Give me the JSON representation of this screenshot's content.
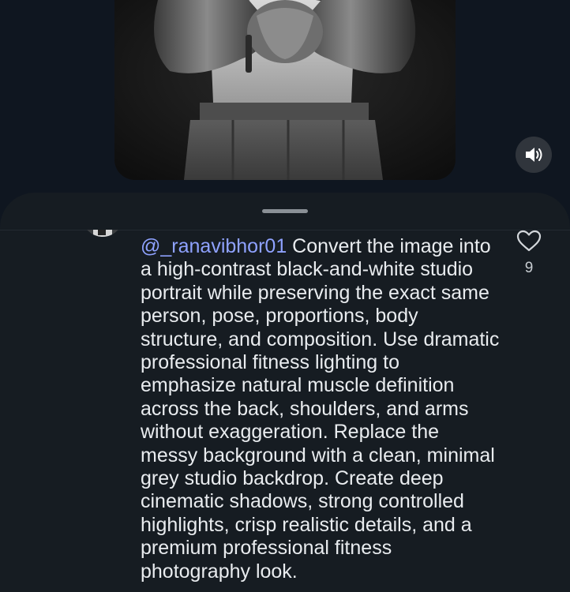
{
  "media": {
    "image_description_icon": "person-photo",
    "mute_icon": "speaker-icon"
  },
  "comment": {
    "mention": "@_ranavibhor01",
    "text": " Convert the image into a high-contrast black-and-white studio portrait while preserving the exact same person, pose, proportions, body structure, and composition. Use dramatic professional fitness lighting to emphasize natural muscle definition across the back, shoulders, and arms without exaggeration. Replace the messy background with a clean, minimal grey studio backdrop. Create deep cinematic shadows, strong controlled highlights, crisp realistic details, and a premium professional fitness photography look.",
    "like_count": "9"
  },
  "colors": {
    "background": "#0f1620",
    "sheet": "#161c22",
    "mention": "#8fa2ff",
    "text": "#e9ecef"
  }
}
